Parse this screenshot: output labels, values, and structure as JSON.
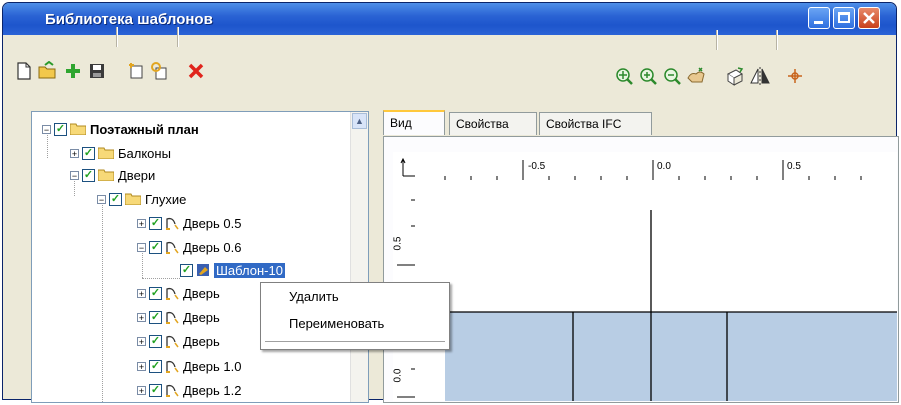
{
  "window": {
    "title": "Библиотека шаблонов"
  },
  "colors": {
    "titlebar": "#2a63d4",
    "selection": "#316ac5",
    "fill_area": "#b8cde4",
    "checkmark": "#21a121"
  },
  "toolbar": {
    "left_icons": [
      "new-file-icon",
      "open-folder-icon",
      "add-icon",
      "save-icon",
      "properties-icon",
      "copy-icon",
      "delete-icon"
    ],
    "right_icons": [
      "zoom-fit-icon",
      "zoom-in-icon",
      "zoom-out-icon",
      "pan-icon",
      "rotate-icon",
      "mirror-icon",
      "origin-icon"
    ]
  },
  "tree": {
    "items": [
      {
        "label": "Поэтажный план",
        "exp": "−"
      },
      {
        "label": "Балконы",
        "exp": "+"
      },
      {
        "label": "Двери",
        "exp": "−"
      },
      {
        "label": "Глухие",
        "exp": "−"
      },
      {
        "label": "Дверь 0.5",
        "exp": "+"
      },
      {
        "label": "Дверь 0.6",
        "exp": "−"
      },
      {
        "label": "Шаблон-10",
        "exp": ""
      },
      {
        "label": "Дверь",
        "exp": "+"
      },
      {
        "label": "Дверь",
        "exp": "+"
      },
      {
        "label": "Дверь",
        "exp": "+"
      },
      {
        "label": "Дверь 1.0",
        "exp": "+"
      },
      {
        "label": "Дверь 1.2",
        "exp": "+"
      }
    ]
  },
  "tabs": [
    {
      "label": "Вид"
    },
    {
      "label": "Свойства"
    },
    {
      "label": "Свойства IFC"
    }
  ],
  "ruler": {
    "x_ticks": [
      "-0.5",
      "0.0",
      "0.5"
    ],
    "y_ticks": [
      "0.5",
      "0.0"
    ]
  },
  "context_menu": {
    "items": [
      "Удалить",
      "Переименовать"
    ]
  }
}
